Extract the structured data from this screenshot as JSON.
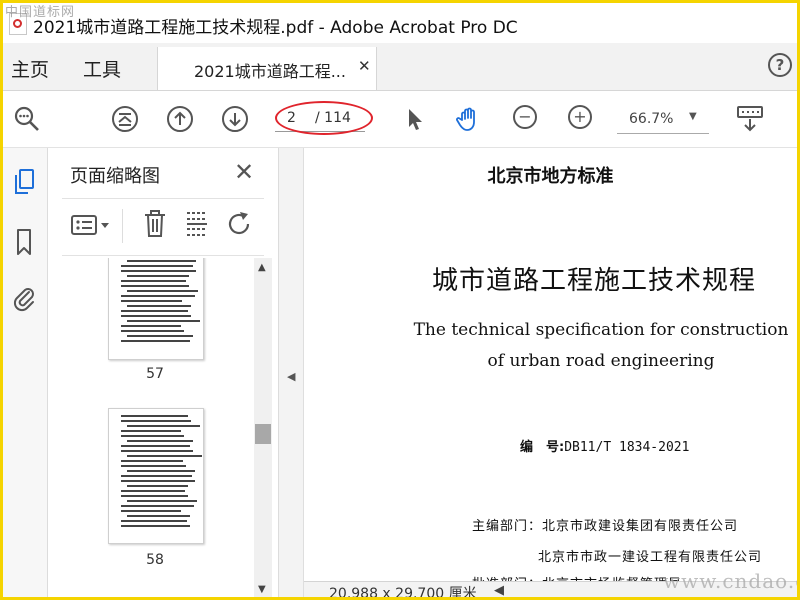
{
  "window": {
    "title": "2021城市道路工程施工技术规程.pdf - Adobe Acrobat Pro DC",
    "watermark_top": "中国道标网",
    "watermark_bottom": "www.cndao.com"
  },
  "menu": {
    "home": "主页",
    "tools": "工具",
    "doc_tab": "2021城市道路工程...",
    "help": "?"
  },
  "toolbar": {
    "page_current": "2",
    "page_total": "/ 114",
    "zoom": "66.7%",
    "highlight_color": "#e0242c"
  },
  "panel": {
    "title": "页面缩略图",
    "thumbnails": [
      {
        "label": "57"
      },
      {
        "label": "58"
      }
    ]
  },
  "document": {
    "header": "北京市地方标准",
    "title": "城市道路工程施工技术规程",
    "english_line1": "The technical specification for construction",
    "english_line2": "of urban road engineering",
    "code_label": "编　号:",
    "code_value": "DB11/T 1834-2021",
    "org_line1": "主编部门：北京市政建设集团有限责任公司",
    "org_line2": "北京市市政一建设工程有限责任公司",
    "org_line3": "批准部门：北京市市场监督管理局"
  },
  "status": {
    "page_size": "20.988 x 29.700 厘米"
  }
}
